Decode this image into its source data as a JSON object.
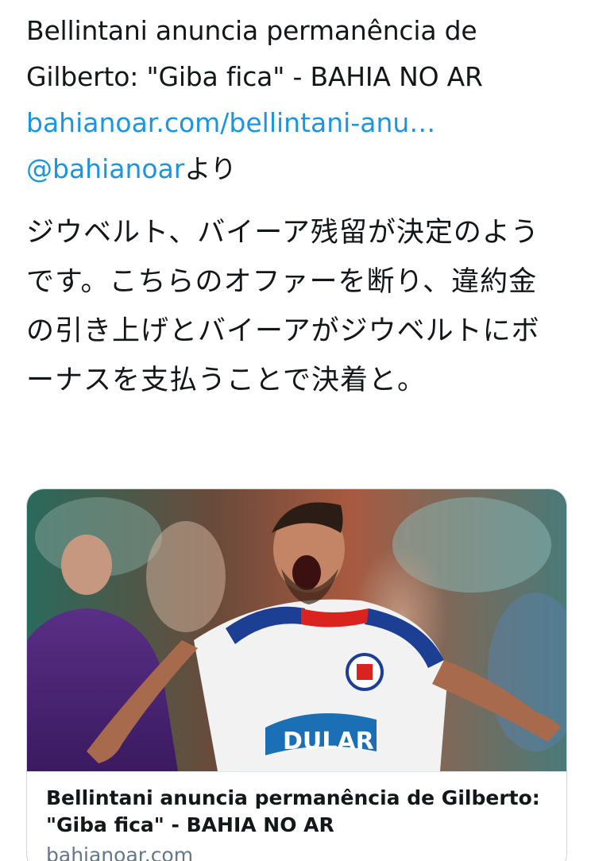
{
  "tweet": {
    "headline": "Bellintani anuncia permanência de Gilberto: \"Giba fica\" - BAHIA NO AR",
    "link_text": "bahianoar.com/bellintani-anu…",
    "via_handle": "@bahianoar",
    "via_suffix": "より",
    "body": "ジウベルト、バイーア残留が決定のようです。こちらのオファーを断り、違約金の引き上げとバイーアがジウベルトにボーナスを支払うことで決着と。"
  },
  "card": {
    "image_icon": "soccer-player-celebrating-photo",
    "jersey_sponsor": "DULAR",
    "title": "Bellintani anuncia permanência de Gilberto: \"Giba fica\" - BAHIA NO AR",
    "domain": "bahianoar.com"
  },
  "colors": {
    "link_blue": "#1b95e0",
    "text_dark": "#14171a",
    "muted_gray": "#657786",
    "card_border": "#ccd6dd"
  }
}
